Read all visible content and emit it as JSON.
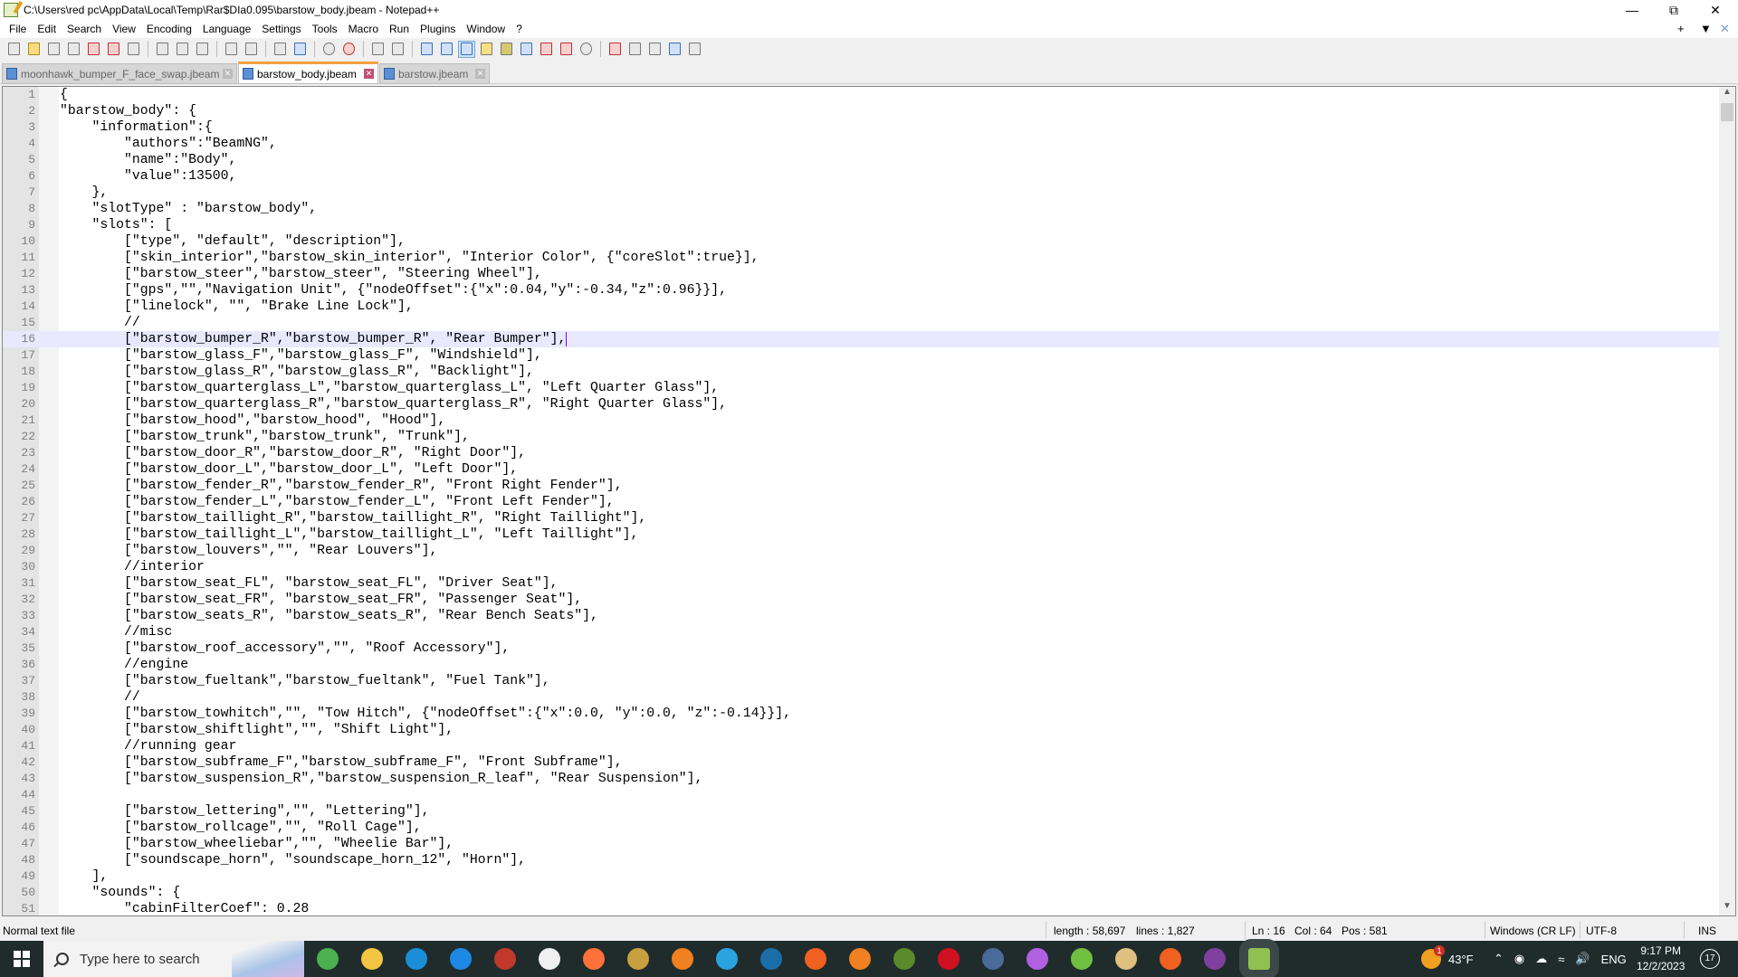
{
  "window": {
    "title": "C:\\Users\\red pc\\AppData\\Local\\Temp\\Rar$DIa0.095\\barstow_body.jbeam - Notepad++"
  },
  "menu": [
    "File",
    "Edit",
    "Search",
    "View",
    "Encoding",
    "Language",
    "Settings",
    "Tools",
    "Macro",
    "Run",
    "Plugins",
    "Window",
    "?"
  ],
  "tabs": [
    {
      "label": "moonhawk_bumper_F_face_swap.jbeam",
      "active": false
    },
    {
      "label": "barstow_body.jbeam",
      "active": true
    },
    {
      "label": "barstow.jbeam",
      "active": false
    }
  ],
  "editor": {
    "current_line": 16,
    "lines": [
      "{",
      "\"barstow_body\": {",
      "    \"information\":{",
      "        \"authors\":\"BeamNG\",",
      "        \"name\":\"Body\",",
      "        \"value\":13500,",
      "    },",
      "    \"slotType\" : \"barstow_body\",",
      "    \"slots\": [",
      "        [\"type\", \"default\", \"description\"],",
      "        [\"skin_interior\",\"barstow_skin_interior\", \"Interior Color\", {\"coreSlot\":true}],",
      "        [\"barstow_steer\",\"barstow_steer\", \"Steering Wheel\"],",
      "        [\"gps\",\"\",\"Navigation Unit\", {\"nodeOffset\":{\"x\":0.04,\"y\":-0.34,\"z\":0.96}}],",
      "        [\"linelock\", \"\", \"Brake Line Lock\"],",
      "        //",
      "        [\"barstow_bumper_R\",\"barstow_bumper_R\", \"Rear Bumper\"],",
      "        [\"barstow_glass_F\",\"barstow_glass_F\", \"Windshield\"],",
      "        [\"barstow_glass_R\",\"barstow_glass_R\", \"Backlight\"],",
      "        [\"barstow_quarterglass_L\",\"barstow_quarterglass_L\", \"Left Quarter Glass\"],",
      "        [\"barstow_quarterglass_R\",\"barstow_quarterglass_R\", \"Right Quarter Glass\"],",
      "        [\"barstow_hood\",\"barstow_hood\", \"Hood\"],",
      "        [\"barstow_trunk\",\"barstow_trunk\", \"Trunk\"],",
      "        [\"barstow_door_R\",\"barstow_door_R\", \"Right Door\"],",
      "        [\"barstow_door_L\",\"barstow_door_L\", \"Left Door\"],",
      "        [\"barstow_fender_R\",\"barstow_fender_R\", \"Front Right Fender\"],",
      "        [\"barstow_fender_L\",\"barstow_fender_L\", \"Front Left Fender\"],",
      "        [\"barstow_taillight_R\",\"barstow_taillight_R\", \"Right Taillight\"],",
      "        [\"barstow_taillight_L\",\"barstow_taillight_L\", \"Left Taillight\"],",
      "        [\"barstow_louvers\",\"\", \"Rear Louvers\"],",
      "        //interior",
      "        [\"barstow_seat_FL\", \"barstow_seat_FL\", \"Driver Seat\"],",
      "        [\"barstow_seat_FR\", \"barstow_seat_FR\", \"Passenger Seat\"],",
      "        [\"barstow_seats_R\", \"barstow_seats_R\", \"Rear Bench Seats\"],",
      "        //misc",
      "        [\"barstow_roof_accessory\",\"\", \"Roof Accessory\"],",
      "        //engine",
      "        [\"barstow_fueltank\",\"barstow_fueltank\", \"Fuel Tank\"],",
      "        //",
      "        [\"barstow_towhitch\",\"\", \"Tow Hitch\", {\"nodeOffset\":{\"x\":0.0, \"y\":0.0, \"z\":-0.14}}],",
      "        [\"barstow_shiftlight\",\"\", \"Shift Light\"],",
      "        //running gear",
      "        [\"barstow_subframe_F\",\"barstow_subframe_F\", \"Front Subframe\"],",
      "        [\"barstow_suspension_R\",\"barstow_suspension_R_leaf\", \"Rear Suspension\"],",
      "",
      "        [\"barstow_lettering\",\"\", \"Lettering\"],",
      "        [\"barstow_rollcage\",\"\", \"Roll Cage\"],",
      "        [\"barstow_wheeliebar\",\"\", \"Wheelie Bar\"],",
      "        [\"soundscape_horn\", \"soundscape_horn_12\", \"Horn\"],",
      "    ],",
      "    \"sounds\": {",
      "        \"cabinFilterCoef\": 0.28"
    ]
  },
  "status": {
    "file_type": "Normal text file",
    "length": "length : 58,697",
    "lines": "lines : 1,827",
    "ln": "Ln : 16",
    "col": "Col : 64",
    "pos": "Pos : 581",
    "eol": "Windows (CR LF)",
    "encoding": "UTF-8",
    "mode": "INS"
  },
  "taskbar": {
    "search_placeholder": "Type here to search",
    "apps": [
      {
        "name": "chrome",
        "color": "#4caf50"
      },
      {
        "name": "file-explorer",
        "color": "#f4c542"
      },
      {
        "name": "edge",
        "color": "#1a8fd8"
      },
      {
        "name": "mail",
        "color": "#1e88e5"
      },
      {
        "name": "phcorner",
        "color": "#c0392b"
      },
      {
        "name": "microsoft-store",
        "color": "#f0f0f0"
      },
      {
        "name": "firefox",
        "color": "#ff7139"
      },
      {
        "name": "app-hex",
        "color": "#c8a040"
      },
      {
        "name": "app-orange",
        "color": "#f08020"
      },
      {
        "name": "telegram",
        "color": "#2aa3de"
      },
      {
        "name": "steam",
        "color": "#1b6ea8"
      },
      {
        "name": "app-nodes",
        "color": "#f06020"
      },
      {
        "name": "blender",
        "color": "#f08020"
      },
      {
        "name": "minecraft",
        "color": "#5a8a2a"
      },
      {
        "name": "opera",
        "color": "#d01020"
      },
      {
        "name": "calculator",
        "color": "#4a6a9a"
      },
      {
        "name": "paint-drop",
        "color": "#b060e0"
      },
      {
        "name": "bluestacks",
        "color": "#70c040"
      },
      {
        "name": "paint",
        "color": "#e0c080"
      },
      {
        "name": "app-nodes-2",
        "color": "#f06020"
      },
      {
        "name": "winrar",
        "color": "#8040a0"
      },
      {
        "name": "notepad-plus-plus",
        "color": "#90c050"
      }
    ],
    "weather": "43°F",
    "weather_badge": "1",
    "language": "ENG",
    "time": "9:17 PM",
    "date": "12/2/2023",
    "notifications": "17"
  }
}
